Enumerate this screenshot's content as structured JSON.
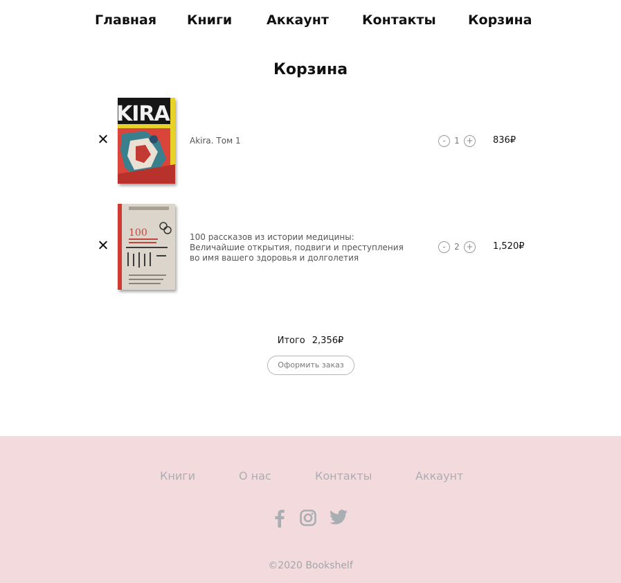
{
  "nav": {
    "home": "Главная",
    "books": "Книги",
    "account": "Аккаунт",
    "contacts": "Контакты",
    "cart": "Корзина"
  },
  "page_title": "Корзина",
  "cart": {
    "items": [
      {
        "title": "Akira. Том 1",
        "quantity": "1",
        "price": "836₽",
        "minus": "-",
        "plus": "+"
      },
      {
        "title": "100 рассказов из истории медицины: Величайшие открытия, подвиги и преступления во имя вашего здоровья и долголетия",
        "quantity": "2",
        "price": "1,520₽",
        "minus": "-",
        "plus": "+"
      }
    ],
    "total_label": "Итого",
    "total_value": "2,356₽",
    "checkout_label": "Оформить заказ"
  },
  "footer": {
    "links": [
      "Книги",
      "О нас",
      "Контакты",
      "Аккаунт"
    ],
    "social_icons": [
      "facebook-icon",
      "instagram-icon",
      "twitter-icon"
    ],
    "copyright": "©2020 Bookshelf",
    "background": "#f3dadd"
  }
}
